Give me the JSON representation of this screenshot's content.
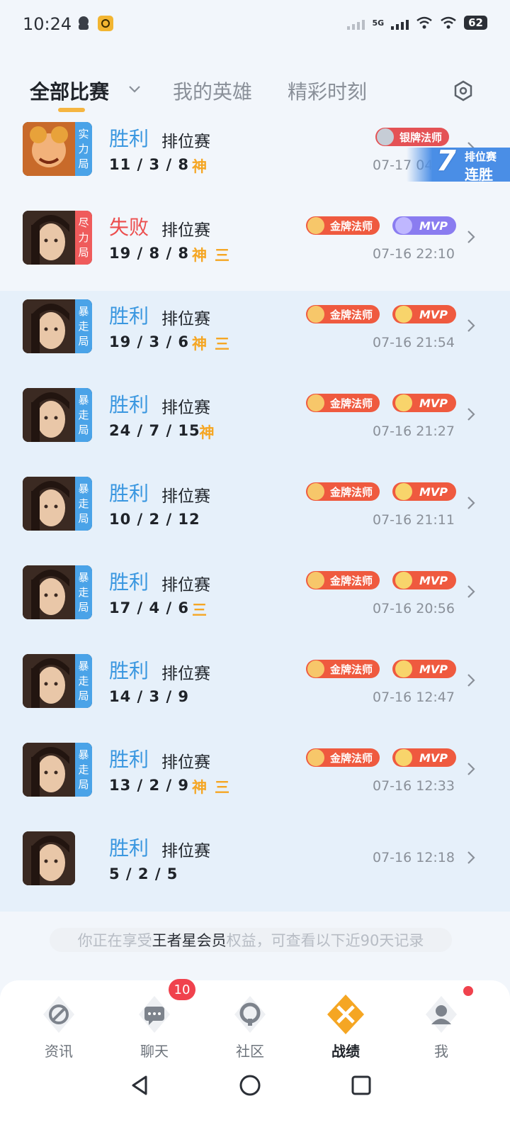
{
  "status_bar": {
    "time": "10:24",
    "battery": "62",
    "network": "5G"
  },
  "tabs": [
    {
      "label": "全部比赛",
      "active": true
    },
    {
      "label": "我的英雄",
      "active": false
    },
    {
      "label": "精彩时刻",
      "active": false
    }
  ],
  "streak": {
    "count": "7",
    "mode": "排位赛",
    "label": "连胜"
  },
  "matches": [
    {
      "result": "胜利",
      "type": "排位赛",
      "kda": "11 / 3 / 8",
      "marks": [
        "神"
      ],
      "badge": "银牌法师",
      "badge_tier": "silver",
      "mvp": false,
      "datetime": "07-17 04:02",
      "tag": "实力局",
      "tag_color": "blue"
    },
    {
      "result": "失败",
      "type": "排位赛",
      "kda": "19 / 8 / 8",
      "marks": [
        "神",
        "三"
      ],
      "badge": "金牌法师",
      "badge_tier": "gold",
      "mvp": true,
      "mvp_label": "MVP",
      "mvp_style": "purple",
      "datetime": "07-16 22:10",
      "tag": "尽力局",
      "tag_color": "red"
    },
    {
      "result": "胜利",
      "type": "排位赛",
      "kda": "19 / 3 / 6",
      "marks": [
        "神",
        "三"
      ],
      "badge": "金牌法师",
      "badge_tier": "gold",
      "mvp": true,
      "mvp_label": "MVP",
      "mvp_style": "gold",
      "datetime": "07-16 21:54",
      "tag": "暴走局",
      "tag_color": "blue"
    },
    {
      "result": "胜利",
      "type": "排位赛",
      "kda": "24 / 7 / 15",
      "marks": [
        "神"
      ],
      "badge": "金牌法师",
      "badge_tier": "gold",
      "mvp": true,
      "mvp_label": "MVP",
      "mvp_style": "gold",
      "datetime": "07-16 21:27",
      "tag": "暴走局",
      "tag_color": "blue"
    },
    {
      "result": "胜利",
      "type": "排位赛",
      "kda": "10 / 2 / 12",
      "marks": [],
      "badge": "金牌法师",
      "badge_tier": "gold",
      "mvp": true,
      "mvp_label": "MVP",
      "mvp_style": "gold",
      "datetime": "07-16 21:11",
      "tag": "暴走局",
      "tag_color": "blue"
    },
    {
      "result": "胜利",
      "type": "排位赛",
      "kda": "17 / 4 / 6",
      "marks": [
        "三"
      ],
      "badge": "金牌法师",
      "badge_tier": "gold",
      "mvp": true,
      "mvp_label": "MVP",
      "mvp_style": "gold",
      "datetime": "07-16 20:56",
      "tag": "暴走局",
      "tag_color": "blue"
    },
    {
      "result": "胜利",
      "type": "排位赛",
      "kda": "14 / 3 / 9",
      "marks": [],
      "badge": "金牌法师",
      "badge_tier": "gold",
      "mvp": true,
      "mvp_label": "MVP",
      "mvp_style": "gold",
      "datetime": "07-16 12:47",
      "tag": "暴走局",
      "tag_color": "blue"
    },
    {
      "result": "胜利",
      "type": "排位赛",
      "kda": "13 / 2 / 9",
      "marks": [
        "神",
        "三"
      ],
      "badge": "金牌法师",
      "badge_tier": "gold",
      "mvp": true,
      "mvp_label": "MVP",
      "mvp_style": "gold",
      "datetime": "07-16 12:33",
      "tag": "暴走局",
      "tag_color": "blue"
    },
    {
      "result": "胜利",
      "type": "排位赛",
      "kda": "5 / 2 / 5",
      "marks": [],
      "badge": null,
      "mvp": false,
      "datetime": "07-16 12:18",
      "tag": null
    }
  ],
  "notice": {
    "prefix": "你正在享受",
    "highlight": "王者星会员",
    "suffix": "权益，可查看以下近90天记录"
  },
  "bottom_nav": [
    {
      "label": "资讯",
      "icon": "news-icon",
      "active": false
    },
    {
      "label": "聊天",
      "icon": "chat-icon",
      "active": false,
      "badge": "10"
    },
    {
      "label": "社区",
      "icon": "community-icon",
      "active": false
    },
    {
      "label": "战绩",
      "icon": "battle-record-icon",
      "active": true
    },
    {
      "label": "我",
      "icon": "profile-icon",
      "active": false,
      "dot": true
    }
  ],
  "colors": {
    "win": "#3a97e0",
    "lose": "#ec4d4d",
    "accent": "#f5b541",
    "highlight_row": "#e6f0fa"
  }
}
